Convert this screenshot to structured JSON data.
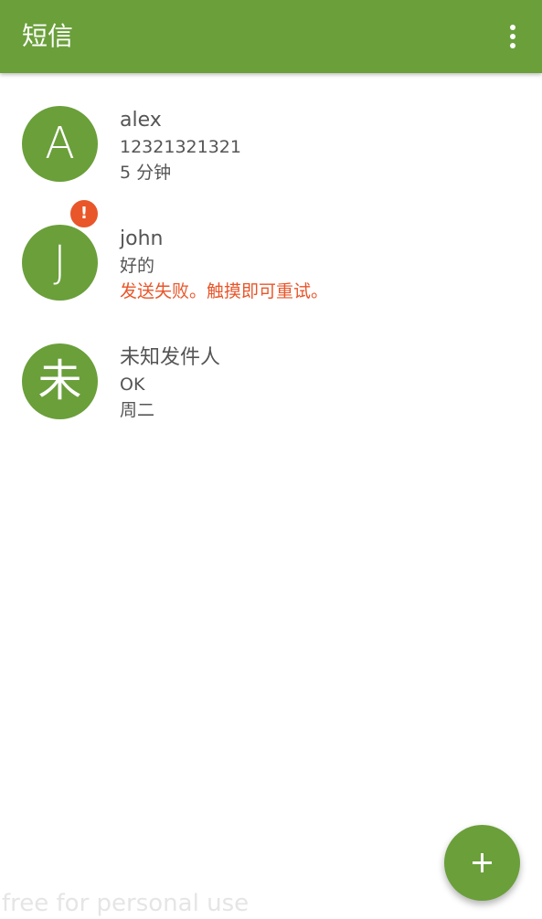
{
  "appbar": {
    "title": "短信",
    "overflow_icon": "more-vert-icon",
    "background": "#6a9f3a"
  },
  "conversations": [
    {
      "avatar_letter": "A",
      "name": "alex",
      "line2": "12321321321",
      "line3": "5 分钟",
      "error": false
    },
    {
      "avatar_letter": "J",
      "name": "john",
      "line2": "好的",
      "line3": "发送失败。触摸即可重试。",
      "error": true,
      "badge_symbol": "!"
    },
    {
      "avatar_letter": "未",
      "name": "未知发件人",
      "line2": "OK",
      "line3": "周二",
      "error": false
    }
  ],
  "fab": {
    "icon": "add-icon"
  },
  "watermark": "free for personal use",
  "colors": {
    "accent": "#6a9f3a",
    "error": "#e8562a",
    "text": "#555555"
  }
}
